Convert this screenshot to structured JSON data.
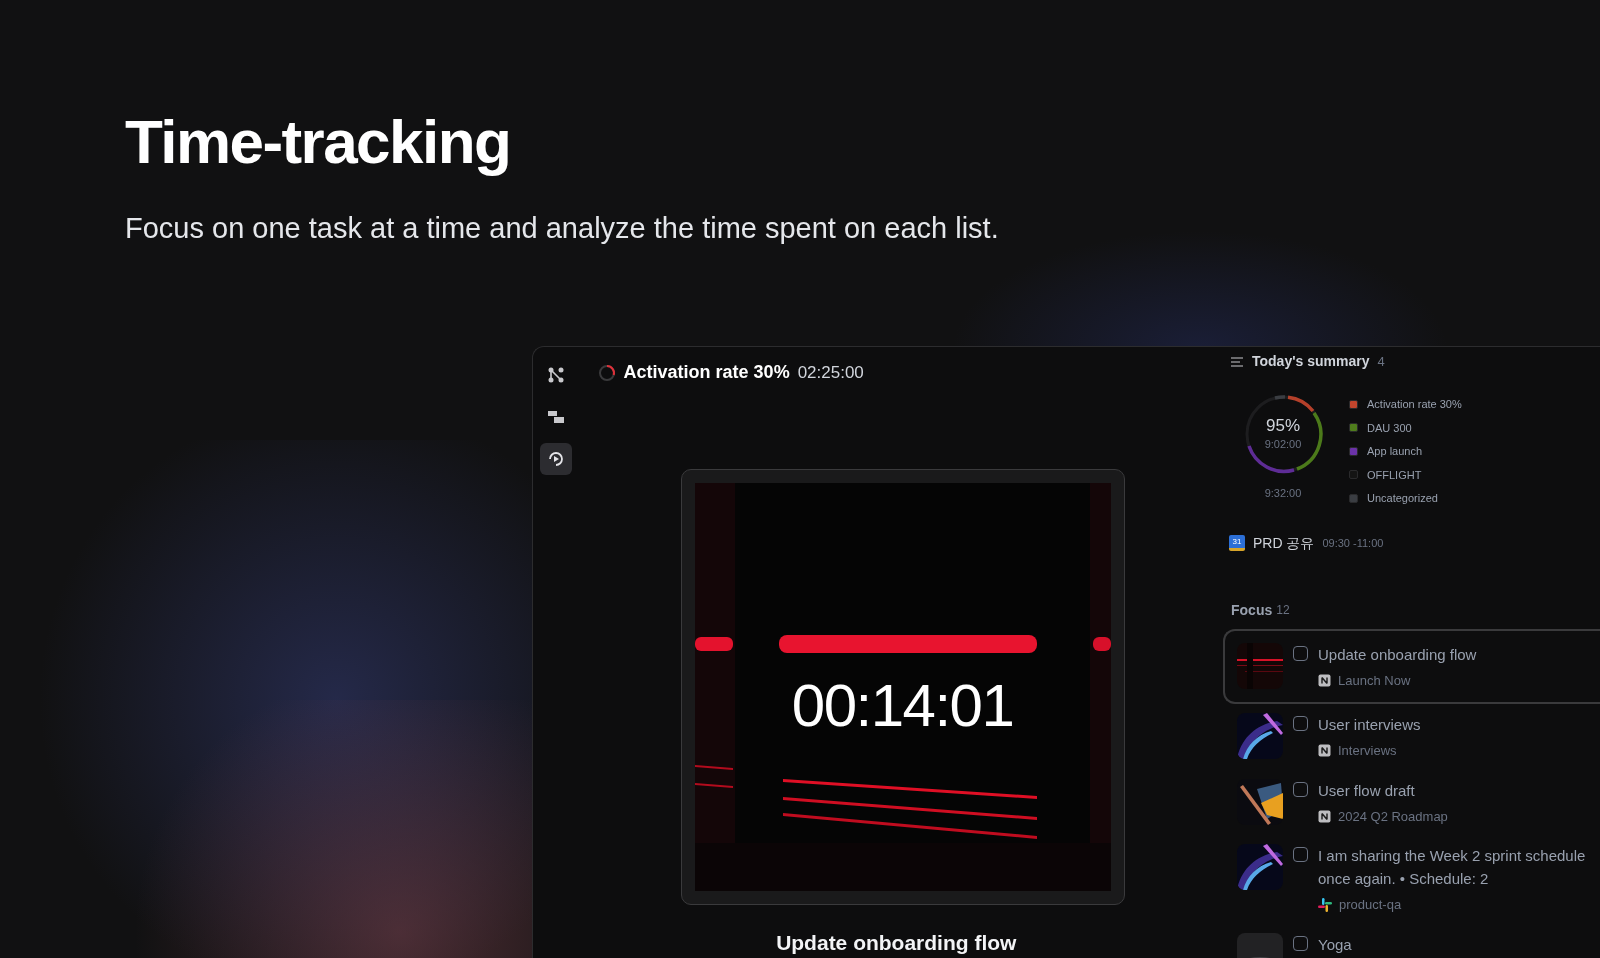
{
  "hero": {
    "title": "Time-tracking",
    "subtitle": "Focus on one task at a time and analyze the time spent on each list."
  },
  "app": {
    "sidebar": [
      {
        "kind": "graph",
        "selected": false
      },
      {
        "kind": "blocks",
        "selected": false
      },
      {
        "kind": "play",
        "selected": true
      }
    ],
    "current": {
      "title": "Activation rate 30%",
      "elapsed": "02:25:00"
    },
    "timer": {
      "time": "00:14:01",
      "task": "Update onboarding flow"
    },
    "summary": {
      "title": "Today's summary",
      "count": "4",
      "percent": "95%",
      "tracked": "9:02:00",
      "total": "9:32:00",
      "legend": [
        {
          "label": "Activation rate 30%",
          "color": "#c2452d"
        },
        {
          "label": "DAU 300",
          "color": "#4f7d1c"
        },
        {
          "label": "App launch",
          "color": "#6b32a8"
        },
        {
          "label": "OFFLIGHT",
          "color": "#141414"
        },
        {
          "label": "Uncategorized",
          "color": "#3a3d42"
        }
      ]
    },
    "event": {
      "calendar_day": "31",
      "title": "PRD 공유",
      "time": "09:30 -11:00"
    },
    "focus": {
      "title": "Focus",
      "count": "12",
      "items": [
        {
          "title": "Update onboarding flow",
          "source": {
            "kind": "notion",
            "label": "Launch Now"
          },
          "checked": false,
          "selected": true
        },
        {
          "title": "User interviews",
          "source": {
            "kind": "notion",
            "label": "Interviews"
          },
          "checked": false,
          "selected": false
        },
        {
          "title": "User flow draft",
          "source": {
            "kind": "notion",
            "label": "2024 Q2 Roadmap"
          },
          "checked": false,
          "selected": false
        },
        {
          "title": "I am sharing the Week 2 sprint schedule once again.  • Schedule: 2",
          "source": {
            "kind": "slack",
            "label": "product-qa"
          },
          "checked": false,
          "selected": false
        },
        {
          "title": "Yoga",
          "checked": false,
          "selected": false
        }
      ]
    }
  }
}
